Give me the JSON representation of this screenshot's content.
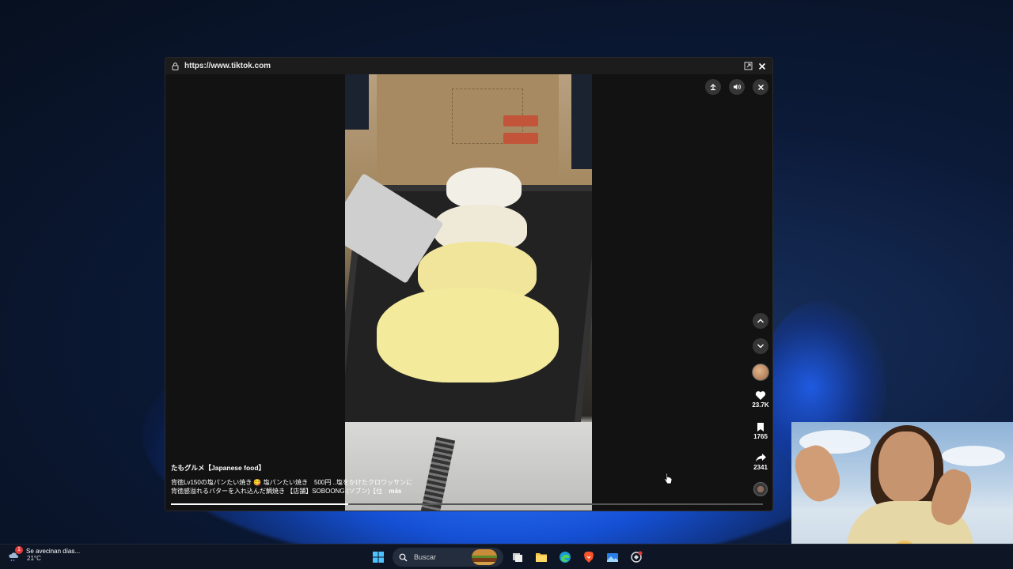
{
  "browser_popup": {
    "url": "https://www.tiktok.com"
  },
  "video": {
    "author": "たもグルメ【Japanese food】",
    "description_line1": "背徳Lv150の塩パンたい焼き 😋 塩パンたい焼き　500円 ..塩をかけたクロワッサンに",
    "description_line2": "背徳感溢れるバターを入れ込んだ鯛焼き 【店舗】SOBOONG (ソブン)【住",
    "more_label": "más",
    "progress_fraction": 0.3
  },
  "actions": {
    "likes": "23.7K",
    "saves": "1765",
    "shares": "2341"
  },
  "taskbar": {
    "weather_text": "Se avecinan días...",
    "weather_temp": "21°C",
    "weather_badge": "1",
    "search_placeholder": "Buscar"
  },
  "icons": {
    "lock": "lock-icon",
    "popout": "popout-icon",
    "close": "close-icon",
    "pip": "picture-in-picture-icon",
    "volume": "volume-icon",
    "up": "chevron-up-icon",
    "down": "chevron-down-icon",
    "heart": "heart-icon",
    "bookmark": "bookmark-icon",
    "share": "share-icon"
  }
}
